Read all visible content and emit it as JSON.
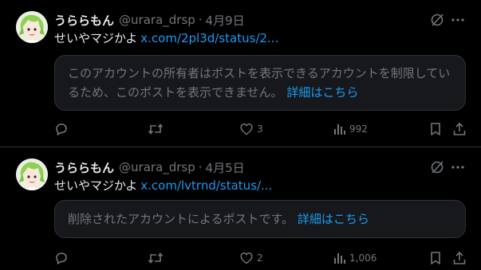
{
  "tweets": [
    {
      "author_name": "うららもん",
      "handle": "@urara_drsp",
      "separator": "·",
      "date": "4月9日",
      "text": "せいやマジかよ",
      "link": "x.com/2pl3d/status/2...",
      "quote_text": "このアカウントの所有者はポストを表示できるアカウントを制限しているため、このポストを表示できません。",
      "quote_link": "詳細はこちら",
      "likes": "3",
      "views": "992",
      "icons": [
        "grok-icon",
        "more-icon",
        "reply-icon",
        "retweet-icon",
        "like-icon",
        "views-icon",
        "bookmark-icon",
        "share-icon"
      ]
    },
    {
      "author_name": "うららもん",
      "handle": "@urara_drsp",
      "separator": "·",
      "date": "4月5日",
      "text": "せいやマジかよ",
      "link": "x.com/lvtrnd/status/...",
      "quote_text": "削除されたアカウントによるポストです。",
      "quote_link": "詳細はこちら",
      "likes": "2",
      "views": "1,006",
      "icons": [
        "grok-icon",
        "more-icon",
        "reply-icon",
        "retweet-icon",
        "like-icon",
        "views-icon",
        "bookmark-icon",
        "share-icon"
      ]
    }
  ],
  "colors": {
    "background": "#000000",
    "text": "#e7e9ea",
    "muted": "#71767b",
    "link": "#1d9bf0",
    "border": "#2f3336",
    "card": "#16181c"
  }
}
